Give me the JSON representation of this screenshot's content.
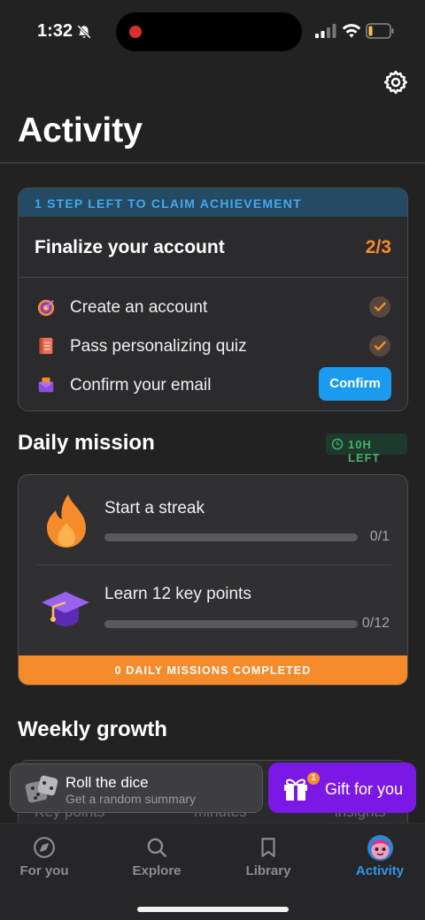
{
  "status_bar": {
    "time": "1:32"
  },
  "header": {
    "title": "Activity"
  },
  "achievement": {
    "banner": "1 STEP LEFT TO CLAIM ACHIEVEMENT",
    "title": "Finalize your account",
    "progress": "2/3",
    "tasks": [
      {
        "label": "Create an account",
        "icon": "target-icon",
        "done": true
      },
      {
        "label": "Pass personalizing quiz",
        "icon": "notebook-icon",
        "done": true
      },
      {
        "label": "Confirm your email",
        "icon": "envelope-icon",
        "done": false
      }
    ],
    "confirm_label": "Confirm"
  },
  "daily": {
    "title": "Daily mission",
    "time_left": "10H LEFT",
    "missions": [
      {
        "label": "Start a streak",
        "count": "0/1",
        "progress": 0,
        "icon": "flame-icon"
      },
      {
        "label": "Learn 12 key points",
        "count": "0/12",
        "progress": 0,
        "icon": "graduation-cap-icon"
      }
    ],
    "footer": "0 DAILY MISSIONS COMPLETED"
  },
  "weekly": {
    "title": "Weekly growth",
    "peek_labels": [
      "Key points",
      "minutes",
      "insights"
    ]
  },
  "promo": {
    "dice_title": "Roll the dice",
    "dice_subtitle": "Get a random summary",
    "gift_label": "Gift for you",
    "gift_badge": "1"
  },
  "tabbar": {
    "tabs": [
      {
        "label": "For you",
        "icon": "compass-icon",
        "active": false
      },
      {
        "label": "Explore",
        "icon": "search-icon",
        "active": false
      },
      {
        "label": "Library",
        "icon": "bookmark-icon",
        "active": false
      },
      {
        "label": "Activity",
        "icon": "avatar-icon",
        "active": true
      }
    ]
  },
  "colors": {
    "accent_orange": "#f58b2b",
    "accent_blue": "#1a9bf0",
    "active_tab": "#2f96ef",
    "inactive_tab": "#8d8c8e",
    "gift_purple": "#7b18e6"
  }
}
